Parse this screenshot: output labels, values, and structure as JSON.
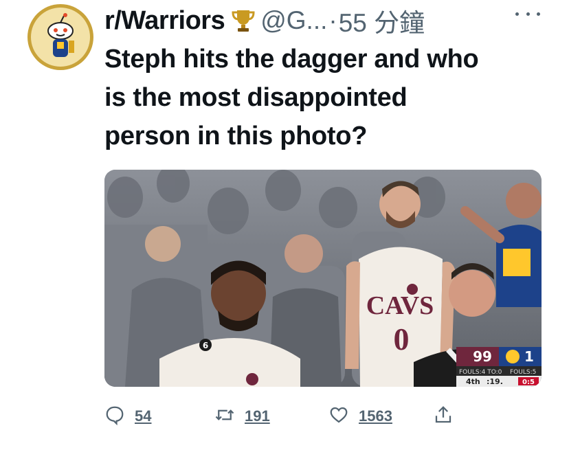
{
  "tweet": {
    "account_name": "r/Warriors",
    "handle": "@G...",
    "separator": "·",
    "time": "55 分鐘",
    "text_lines": [
      "Steph hits the dagger and who",
      "is the most disappointed",
      "person in this photo?"
    ]
  },
  "media": {
    "jersey_brand": "CAVS",
    "jersey_number_big": "0",
    "jersey_number_small": "6",
    "scorebug": {
      "home_score": "99",
      "away_score": "1",
      "fouls": "FOULS:4 TO:0",
      "fouls_right": "FOULS:5",
      "quarter": "4th",
      "clock": ":19.",
      "extra": "0:5"
    }
  },
  "actions": {
    "replies": "54",
    "retweets": "191",
    "likes": "1563"
  },
  "colors": {
    "text": "#0f1419",
    "secondary": "#536471",
    "cavs_wine": "#6f263d",
    "warriors_blue": "#1d428a",
    "warriors_gold": "#ffc72c"
  },
  "icons": [
    "reddit-avatar-icon",
    "trophy-icon",
    "more-icon",
    "reply-icon",
    "retweet-icon",
    "like-icon",
    "share-icon"
  ]
}
